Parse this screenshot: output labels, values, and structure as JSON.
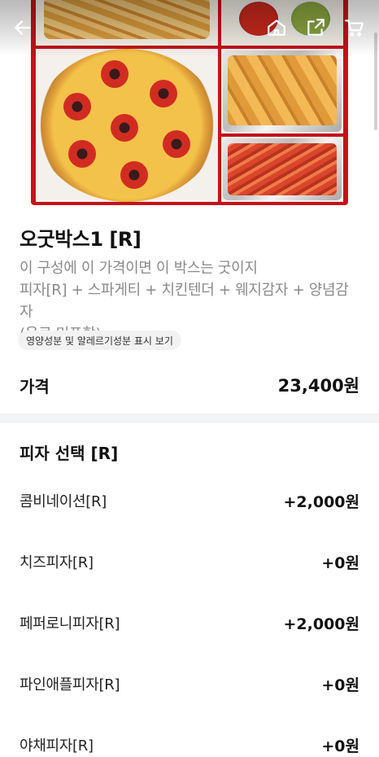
{
  "product": {
    "title": "오굿박스1 [R]",
    "description_line1": "이 구성에 이 가격이면 이 박스는 굿이지",
    "description_line2": "피자[R] + 스파게티 + 치킨텐더 + 웨지감자 + 양념감자",
    "description_line3": "(음료 미포함)",
    "nutrition_link": "영양성분 및 알레르기성분 표시 보기",
    "price_label": "가격",
    "price_value": "23,400원"
  },
  "header_icons": {
    "back": "back-arrow-icon",
    "home": "home-icon",
    "share": "share-icon",
    "cart": "cart-icon"
  },
  "options": {
    "section_title": "피자 선택 [R]",
    "items": [
      {
        "name": "콤비네이션[R]",
        "price": "+2,000원"
      },
      {
        "name": "치즈피자[R]",
        "price": "+0원"
      },
      {
        "name": "페퍼로니피자[R]",
        "price": "+2,000원"
      },
      {
        "name": "파인애플피자[R]",
        "price": "+0원"
      },
      {
        "name": "야채피자[R]",
        "price": "+0원"
      }
    ]
  },
  "colors": {
    "tray": "#c4121a",
    "divider": "#f2f3f5",
    "description": "#8a8a8a"
  }
}
